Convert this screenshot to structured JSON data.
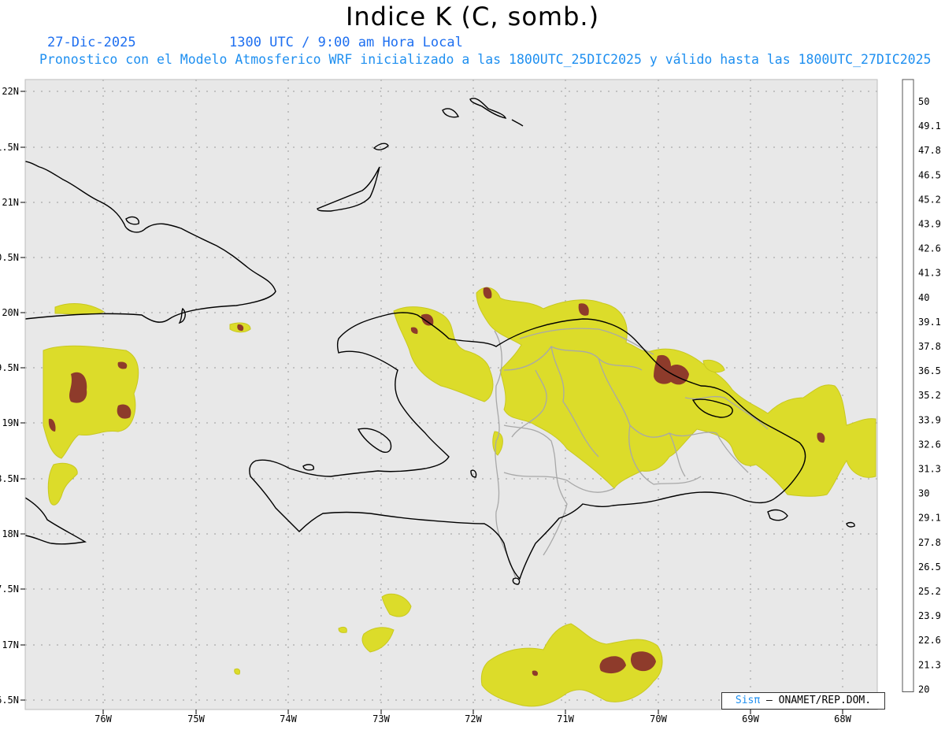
{
  "header": {
    "title": "Indice K (C, somb.)",
    "date": "27-Dic-2025",
    "time": "1300 UTC / 9:00 am Hora Local",
    "description": "Pronostico con el Modelo Atmosferico WRF inicializado a las 1800UTC_25DIC2025 y válido hasta las  1800UTC_27DIC2025"
  },
  "axes": {
    "lat_labels": [
      "22N",
      "1.5N",
      "21N",
      "0.5N",
      "20N",
      "9.5N",
      "19N",
      "8.5N",
      "18N",
      "7.5N",
      "17N",
      "6.5N"
    ],
    "lon_labels": [
      "76W",
      "75W",
      "74W",
      "73W",
      "72W",
      "71W",
      "70W",
      "69W",
      "68W"
    ]
  },
  "legend": {
    "labels": [
      "50",
      "49.1",
      "47.8",
      "46.5",
      "45.2",
      "43.9",
      "42.6",
      "41.3",
      "40",
      "39.1",
      "37.8",
      "36.5",
      "35.2",
      "33.9",
      "32.6",
      "31.3",
      "30",
      "29.1",
      "27.8",
      "26.5",
      "25.2",
      "23.9",
      "22.6",
      "21.3",
      "20"
    ],
    "colors": [
      "#5c0a5c",
      "#72097a",
      "#8a0b98",
      "#a00fb4",
      "#b712c8",
      "#cc17d8",
      "#e01ce8",
      "#f522f5",
      "#ffffff",
      "#f08c8c",
      "#e67878",
      "#dc6a64",
      "#d05c54",
      "#c04e44",
      "#b04236",
      "#9c3626",
      "#7a2a10",
      "#ffff33",
      "#fbfb2c",
      "#f0f02a",
      "#e6e62a",
      "#dada28",
      "#cccc26",
      "#c2c224",
      "#e4e4e4"
    ]
  },
  "credit": {
    "logo": "Sisπ",
    "text": "– ONAMET/REP.DOM."
  },
  "colors": {
    "background": "#e8e8e8",
    "coast": "#000000",
    "provinces": "#a8a8a8",
    "k_low": "#dcdc28",
    "k_high": "#8a3a2a"
  }
}
